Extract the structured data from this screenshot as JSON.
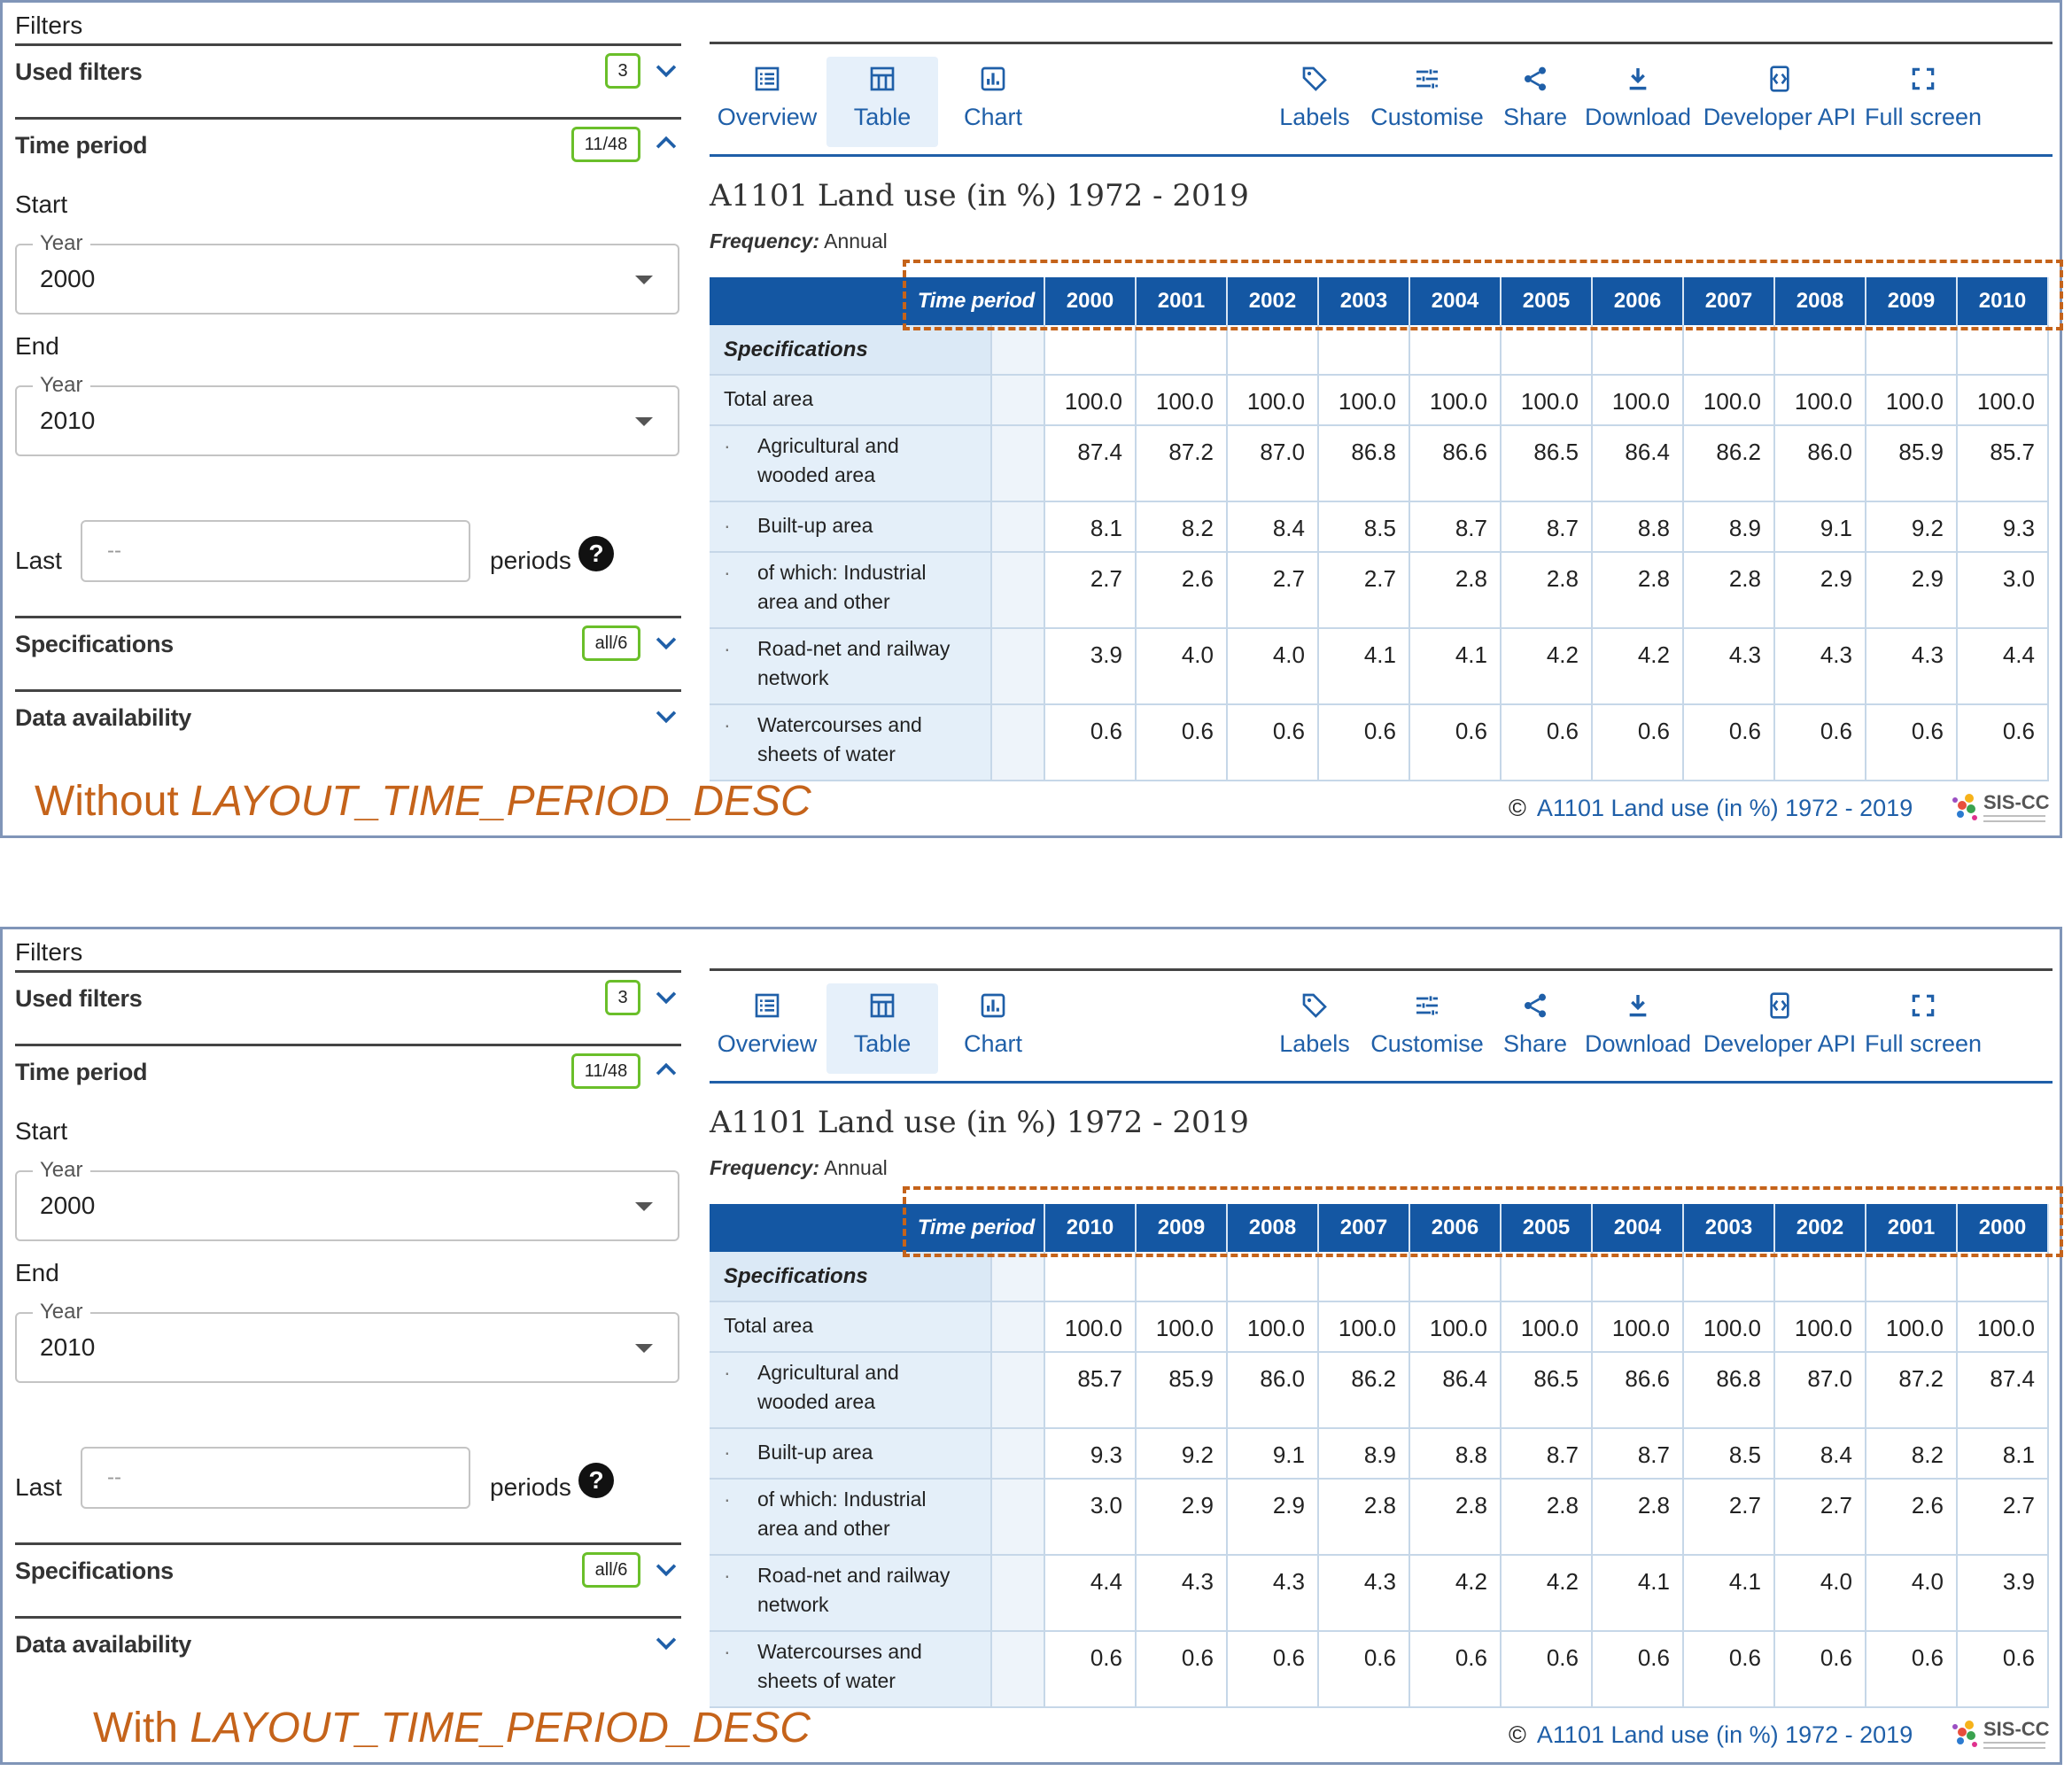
{
  "panels": [
    {
      "filters": {
        "title": "Filters",
        "used_filters": {
          "label": "Used filters",
          "badge": "3"
        },
        "time_period": {
          "label": "Time period",
          "badge": "11/48"
        },
        "start": {
          "label": "Start",
          "legend": "Year",
          "value": "2000"
        },
        "end": {
          "label": "End",
          "legend": "Year",
          "value": "2010"
        },
        "last": {
          "label": "Last",
          "placeholder": "--",
          "periods": "periods",
          "help": "?"
        },
        "specifications": {
          "label": "Specifications",
          "badge": "all/6"
        },
        "data_availability": {
          "label": "Data availability"
        }
      },
      "toolbar": {
        "overview": "Overview",
        "table": "Table",
        "chart": "Chart",
        "labels": "Labels",
        "customise": "Customise",
        "share": "Share",
        "download": "Download",
        "developer_api": "Developer API",
        "full_screen": "Full screen"
      },
      "title": "A1101 Land use (in %) 1972 - 2019",
      "frequency": {
        "label": "Frequency:",
        "value": "Annual"
      },
      "table": {
        "time_period_label": "Time period",
        "specifications_label": "Specifications",
        "years": [
          "2000",
          "2001",
          "2002",
          "2003",
          "2004",
          "2005",
          "2006",
          "2007",
          "2008",
          "2009",
          "2010"
        ],
        "rows": [
          {
            "dot": "",
            "label1": "Total area",
            "label2": "",
            "values": [
              "100.0",
              "100.0",
              "100.0",
              "100.0",
              "100.0",
              "100.0",
              "100.0",
              "100.0",
              "100.0",
              "100.0",
              "100.0"
            ]
          },
          {
            "dot": "·",
            "label1": "Agricultural and",
            "label2": "wooded area",
            "values": [
              "87.4",
              "87.2",
              "87.0",
              "86.8",
              "86.6",
              "86.5",
              "86.4",
              "86.2",
              "86.0",
              "85.9",
              "85.7"
            ]
          },
          {
            "dot": "·",
            "label1": "Built-up area",
            "label2": "",
            "values": [
              "8.1",
              "8.2",
              "8.4",
              "8.5",
              "8.7",
              "8.7",
              "8.8",
              "8.9",
              "9.1",
              "9.2",
              "9.3"
            ]
          },
          {
            "dot": "·",
            "label1": "of which: Industrial",
            "label2": "area and other",
            "values": [
              "2.7",
              "2.6",
              "2.7",
              "2.7",
              "2.8",
              "2.8",
              "2.8",
              "2.8",
              "2.9",
              "2.9",
              "3.0"
            ]
          },
          {
            "dot": "·",
            "label1": "Road-net and railway",
            "label2": "network",
            "values": [
              "3.9",
              "4.0",
              "4.0",
              "4.1",
              "4.1",
              "4.2",
              "4.2",
              "4.3",
              "4.3",
              "4.3",
              "4.4"
            ]
          },
          {
            "dot": "·",
            "label1": "Watercourses and",
            "label2": "sheets of water",
            "values": [
              "0.6",
              "0.6",
              "0.6",
              "0.6",
              "0.6",
              "0.6",
              "0.6",
              "0.6",
              "0.6",
              "0.6",
              "0.6"
            ]
          }
        ]
      },
      "caption": {
        "prefix": "Without ",
        "code": "LAYOUT_TIME_PERIOD_DESC"
      },
      "footer": {
        "copyright": "©",
        "text": "A1101 Land use (in %) 1972 - 2019",
        "logo_text": "SIS-CC"
      }
    },
    {
      "filters": {
        "title": "Filters",
        "used_filters": {
          "label": "Used filters",
          "badge": "3"
        },
        "time_period": {
          "label": "Time period",
          "badge": "11/48"
        },
        "start": {
          "label": "Start",
          "legend": "Year",
          "value": "2000"
        },
        "end": {
          "label": "End",
          "legend": "Year",
          "value": "2010"
        },
        "last": {
          "label": "Last",
          "placeholder": "--",
          "periods": "periods",
          "help": "?"
        },
        "specifications": {
          "label": "Specifications",
          "badge": "all/6"
        },
        "data_availability": {
          "label": "Data availability"
        }
      },
      "toolbar": {
        "overview": "Overview",
        "table": "Table",
        "chart": "Chart",
        "labels": "Labels",
        "customise": "Customise",
        "share": "Share",
        "download": "Download",
        "developer_api": "Developer API",
        "full_screen": "Full screen"
      },
      "title": "A1101 Land use (in %) 1972 - 2019",
      "frequency": {
        "label": "Frequency:",
        "value": "Annual"
      },
      "table": {
        "time_period_label": "Time period",
        "specifications_label": "Specifications",
        "years": [
          "2010",
          "2009",
          "2008",
          "2007",
          "2006",
          "2005",
          "2004",
          "2003",
          "2002",
          "2001",
          "2000"
        ],
        "rows": [
          {
            "dot": "",
            "label1": "Total area",
            "label2": "",
            "values": [
              "100.0",
              "100.0",
              "100.0",
              "100.0",
              "100.0",
              "100.0",
              "100.0",
              "100.0",
              "100.0",
              "100.0",
              "100.0"
            ]
          },
          {
            "dot": "·",
            "label1": "Agricultural and",
            "label2": "wooded area",
            "values": [
              "85.7",
              "85.9",
              "86.0",
              "86.2",
              "86.4",
              "86.5",
              "86.6",
              "86.8",
              "87.0",
              "87.2",
              "87.4"
            ]
          },
          {
            "dot": "·",
            "label1": "Built-up area",
            "label2": "",
            "values": [
              "9.3",
              "9.2",
              "9.1",
              "8.9",
              "8.8",
              "8.7",
              "8.7",
              "8.5",
              "8.4",
              "8.2",
              "8.1"
            ]
          },
          {
            "dot": "·",
            "label1": "of which: Industrial",
            "label2": "area and other",
            "values": [
              "3.0",
              "2.9",
              "2.9",
              "2.8",
              "2.8",
              "2.8",
              "2.8",
              "2.7",
              "2.7",
              "2.6",
              "2.7"
            ]
          },
          {
            "dot": "·",
            "label1": "Road-net and railway",
            "label2": "network",
            "values": [
              "4.4",
              "4.3",
              "4.3",
              "4.3",
              "4.2",
              "4.2",
              "4.1",
              "4.1",
              "4.0",
              "4.0",
              "3.9"
            ]
          },
          {
            "dot": "·",
            "label1": "Watercourses and",
            "label2": "sheets of water",
            "values": [
              "0.6",
              "0.6",
              "0.6",
              "0.6",
              "0.6",
              "0.6",
              "0.6",
              "0.6",
              "0.6",
              "0.6",
              "0.6"
            ]
          }
        ]
      },
      "caption": {
        "prefix": "With ",
        "code": "LAYOUT_TIME_PERIOD_DESC"
      },
      "footer": {
        "copyright": "©",
        "text": "A1101 Land use (in %) 1972 - 2019",
        "logo_text": "SIS-CC"
      }
    }
  ],
  "colors": {
    "accent": "#1f5fa8",
    "header_bg": "#1457a3",
    "badge_border": "#6abf2a",
    "annotation": "#c5631a",
    "panel_border": "#8095b8"
  },
  "icons": [
    "list-icon",
    "table-icon",
    "chart-icon",
    "tag-icon",
    "sliders-icon",
    "share-icon",
    "download-icon",
    "api-icon",
    "fullscreen-icon",
    "chevron-down-icon",
    "chevron-up-icon",
    "help-icon"
  ]
}
